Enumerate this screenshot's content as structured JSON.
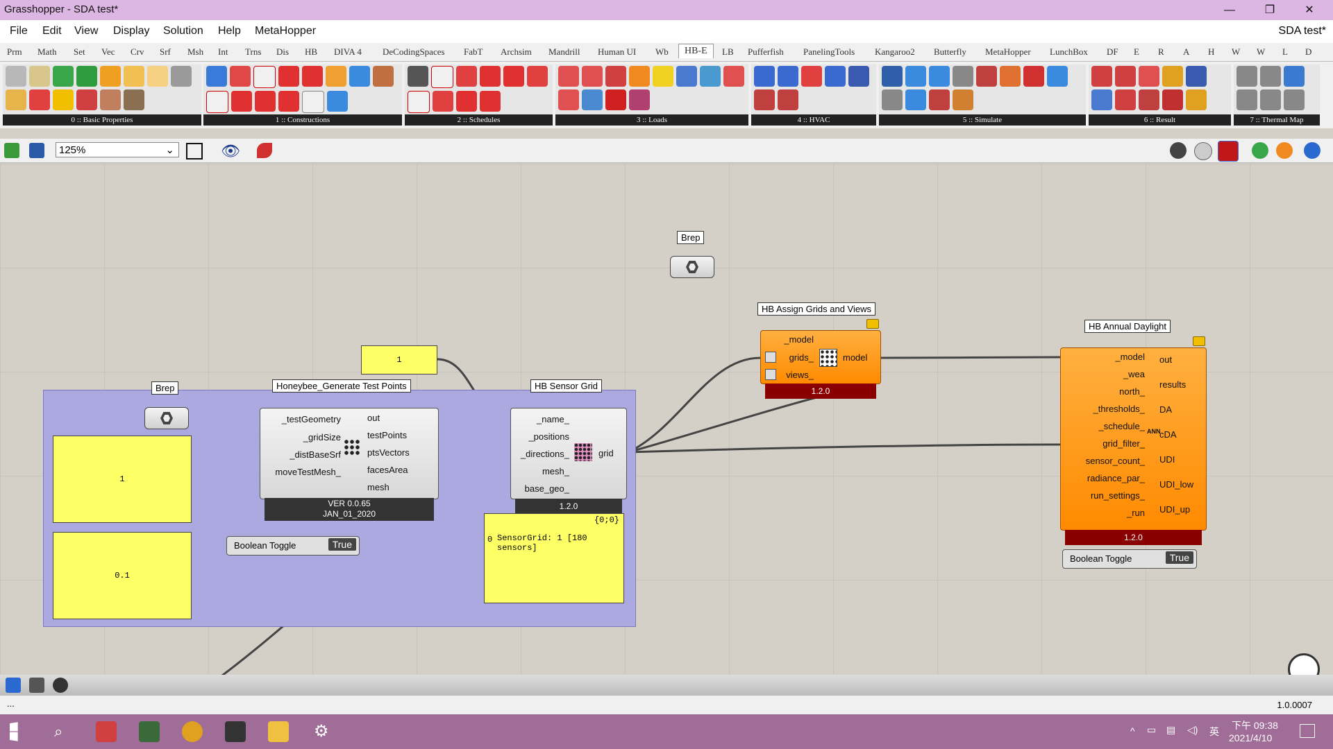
{
  "window": {
    "title": "Grasshopper - SDA test*",
    "minimize": "—",
    "maximize": "❐",
    "close": "✕"
  },
  "menu": {
    "items": [
      "File",
      "Edit",
      "View",
      "Display",
      "Solution",
      "Help",
      "MetaHopper"
    ],
    "doc_name": "SDA test*"
  },
  "tabs": [
    "Prm",
    "Math",
    "Set",
    "Vec",
    "Crv",
    "Srf",
    "Msh",
    "Int",
    "Trns",
    "Dis",
    "HB",
    "DIVA 4",
    "DeCodingSpaces",
    "FabT",
    "Archsim",
    "Mandrill",
    "Human UI",
    "Wb",
    "HB-E",
    "LB",
    "Pufferfish",
    "PanelingTools",
    "Kangaroo2",
    "Butterfly",
    "MetaHopper",
    "LunchBox",
    "DF",
    "E",
    "R",
    "A",
    "H",
    "W",
    "W",
    "L",
    "D"
  ],
  "active_tab": "HB-E",
  "ribbon_panels": [
    "0 :: Basic Properties",
    "1 :: Constructions",
    "2 :: Schedules",
    "3 :: Loads",
    "4 :: HVAC",
    "5 :: Simulate",
    "6 :: Result",
    "7 :: Thermal Map"
  ],
  "toolbar": {
    "zoom": "125%"
  },
  "canvas": {
    "brep_top": {
      "label": "Brep"
    },
    "brep_left": {
      "label": "Brep"
    },
    "slider_top": {
      "value": "1"
    },
    "slider_grid": {
      "value": "1"
    },
    "slider_dist": {
      "value": "0.1"
    },
    "test_points": {
      "title": "Honeybee_Generate Test Points",
      "inputs": [
        "_testGeometry",
        "_gridSize",
        "_distBaseSrf",
        "moveTestMesh_"
      ],
      "outputs": [
        "out",
        "testPoints",
        "ptsVectors",
        "facesArea",
        "mesh"
      ],
      "footer_line1": "VER 0.0.65",
      "footer_line2": "JAN_01_2020"
    },
    "toggle1": {
      "label": "Boolean Toggle",
      "value": "True"
    },
    "sensor_grid": {
      "title": "HB Sensor Grid",
      "inputs": [
        "_name_",
        "_positions",
        "_directions_",
        "mesh_",
        "base_geo_"
      ],
      "output": "grid",
      "version": "1.2.0"
    },
    "panel": {
      "header": "{0;0}",
      "index": "0",
      "text": "SensorGrid: 1 [180 sensors]"
    },
    "assign": {
      "title": "HB Assign Grids and Views",
      "inputs": [
        "_model",
        "grids_",
        "views_"
      ],
      "output": "model",
      "version": "1.2.0"
    },
    "annual": {
      "title": "HB Annual Daylight",
      "inputs": [
        "_model",
        "_wea",
        "north_",
        "_thresholds_",
        "_schedule_",
        "grid_filter_",
        "sensor_count_",
        "radiance_par_",
        "run_settings_",
        "_run"
      ],
      "outputs": [
        "out",
        "results",
        "DA",
        "cDA",
        "UDI",
        "UDI_low",
        "UDI_up"
      ],
      "icon_text": "ANN",
      "version": "1.2.0"
    },
    "toggle2": {
      "label": "Boolean Toggle",
      "value": "True"
    }
  },
  "status": {
    "left": "...",
    "right": "1.0.0007"
  },
  "taskbar": {
    "time": "下午 09:38",
    "date": "2021/4/10",
    "ime": "英"
  },
  "colors": {
    "titlebar": "#dcb7e3",
    "group": "#aca8e0",
    "orange": "#ff9a1a",
    "slider": "#ffff66",
    "taskbar": "#a06c98"
  }
}
